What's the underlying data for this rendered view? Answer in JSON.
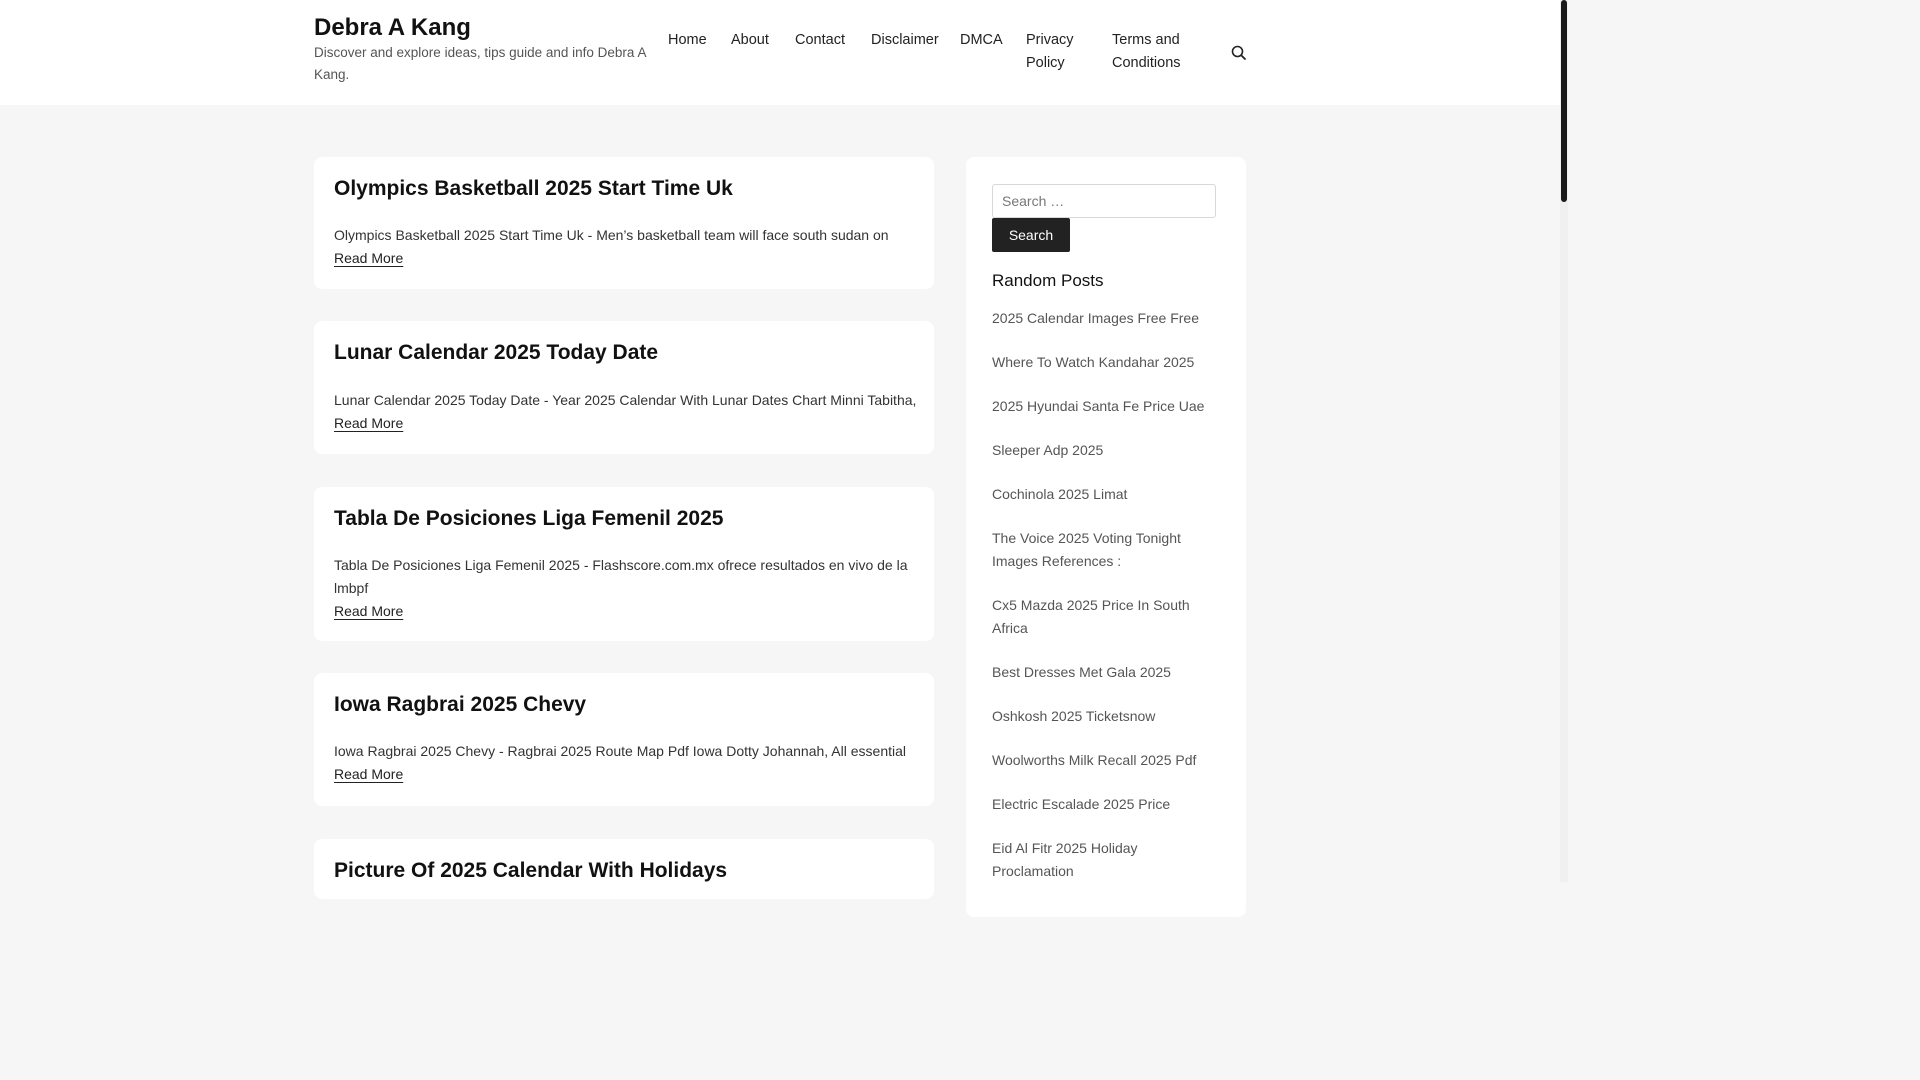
{
  "header": {
    "site_title": "Debra A Kang",
    "site_description": "Discover and explore ideas, tips guide and info Debra A Kang.",
    "nav": [
      {
        "label": "Home"
      },
      {
        "label": "About"
      },
      {
        "label": "Contact"
      },
      {
        "label": "Disclaimer"
      },
      {
        "label": "DMCA"
      },
      {
        "label": "Privacy Policy"
      },
      {
        "label": "Terms and Conditions"
      }
    ],
    "search_icon": "search-icon"
  },
  "posts": [
    {
      "title": "Olympics Basketball 2025 Start Time Uk",
      "excerpt": "Olympics Basketball 2025 Start Time Uk - Men’s basketball team will face south sudan on",
      "read_more": "Read More"
    },
    {
      "title": "Lunar Calendar 2025 Today Date",
      "excerpt": "Lunar Calendar 2025 Today Date - Year 2025 Calendar With Lunar Dates Chart Minni Tabitha,",
      "read_more": "Read More"
    },
    {
      "title": "Tabla De Posiciones Liga Femenil 2025",
      "excerpt": "Tabla De Posiciones Liga Femenil 2025 - Flashscore.com.mx ofrece resultados en vivo de la lmbpf",
      "read_more": "Read More"
    },
    {
      "title": "Iowa Ragbrai 2025 Chevy",
      "excerpt": "Iowa Ragbrai 2025 Chevy - Ragbrai 2025 Route Map Pdf Iowa Dotty Johannah, All essential",
      "read_more": "Read More"
    },
    {
      "title": "Picture Of 2025 Calendar With Holidays",
      "excerpt": "",
      "read_more": ""
    }
  ],
  "sidebar": {
    "search_placeholder": "Search …",
    "search_button": "Search",
    "widget_title": "Random Posts",
    "random_posts": [
      "2025 Calendar Images Free Free",
      "Where To Watch Kandahar 2025",
      "2025 Hyundai Santa Fe Price Uae",
      "Sleeper Adp 2025",
      "Cochinola 2025 Limat",
      "The Voice 2025 Voting Tonight Images References :",
      "Cx5 Mazda 2025 Price In South Africa",
      "Best Dresses Met Gala 2025",
      "Oshkosh 2025 Ticketsnow",
      "Woolworths Milk Recall 2025 Pdf",
      "Electric Escalade 2025 Price",
      "Eid Al Fitr 2025 Holiday Proclamation"
    ]
  }
}
